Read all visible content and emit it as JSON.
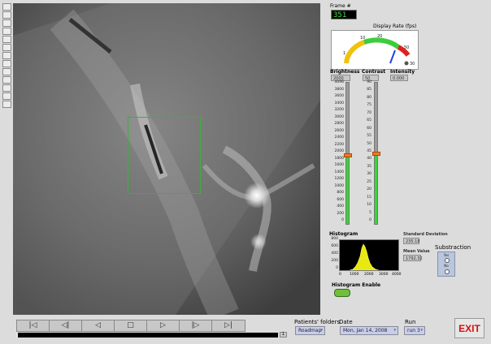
{
  "tools": [
    "arrow-icon",
    "select-icon",
    "hand-icon",
    "cross-icon",
    "zoom-icon",
    "box-icon",
    "circle-icon",
    "rotate-icon",
    "contrast-icon",
    "ruler-icon",
    "marker-icon",
    "reset-icon",
    "sun-icon"
  ],
  "frame": {
    "label": "Frame #",
    "value": "351"
  },
  "gauge": {
    "label": "Display Rate (fps)",
    "ticks": [
      "1",
      "10",
      "20",
      "50",
      "30"
    ],
    "value_fraction": 0.78
  },
  "brightness": {
    "label": "Brightness",
    "value": "2000",
    "ticks": [
      "4096",
      "3800",
      "3600",
      "3400",
      "3200",
      "3000",
      "2800",
      "2600",
      "2400",
      "2200",
      "2000",
      "1800",
      "1600",
      "1400",
      "1200",
      "1000",
      "800",
      "600",
      "400",
      "200",
      "0"
    ],
    "level": 0.49
  },
  "contrast": {
    "label": "Contrast",
    "value": "50",
    "ticks": [
      "90",
      "85",
      "80",
      "75",
      "70",
      "65",
      "60",
      "55",
      "50",
      "45",
      "40",
      "35",
      "30",
      "25",
      "20",
      "15",
      "10",
      "5",
      "0"
    ],
    "level": 0.5
  },
  "intensity": {
    "label": "Intensity",
    "value": "0.000"
  },
  "histogram": {
    "label": "Histogram",
    "y_ticks": [
      "800",
      "600",
      "400",
      "200",
      "0"
    ],
    "x_ticks": [
      "0",
      "1000",
      "2000",
      "3000",
      "4000"
    ],
    "enable_label": "Histogram Enable"
  },
  "stats": {
    "std_label": "Standard Deviation",
    "std_value": "235.18",
    "mean_label": "Mean Value",
    "mean_value": "1792.32"
  },
  "subtraction": {
    "label": "Substraction",
    "option_on": "Yes",
    "option_off": "No"
  },
  "patients": {
    "label": "Patients' folders",
    "value": "Roadmap"
  },
  "date": {
    "label": "Date",
    "value": "Mon, Jan 14, 2008"
  },
  "run": {
    "label": "Run",
    "value": "run 3"
  },
  "exit_label": "EXIT",
  "nav": {
    "first": "|◁",
    "prev_step": "◁|",
    "prev": "◁",
    "stop": "□",
    "play": "▷",
    "next_step": "|▷",
    "last": "▷|"
  },
  "timeline_end": "1"
}
